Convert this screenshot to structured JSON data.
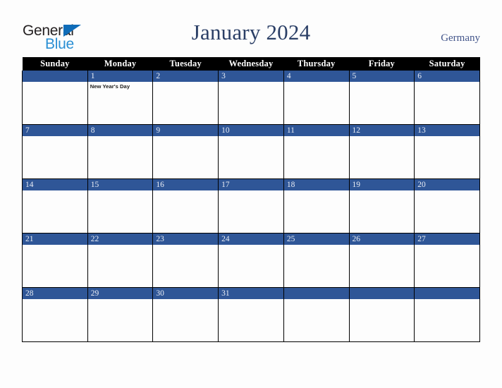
{
  "brand": {
    "name_part1": "General",
    "name_part2": "Blue",
    "triangle_color": "#0f6cb8",
    "blue_text_color": "#2a8fd4",
    "dark_text_color": "#231f20"
  },
  "header": {
    "title": "January 2024",
    "country": "Germany",
    "title_color": "#2b3f66",
    "country_color": "#44568b"
  },
  "theme": {
    "header_row_bg": "#000000",
    "header_row_text": "#ffffff",
    "day_band_bg": "#2f5697",
    "day_band_text": "#e9edf5",
    "cell_bg": "#fdfdfd",
    "grid_line": "#000000",
    "page_bg": "#fdfdfd"
  },
  "weekdays": [
    "Sunday",
    "Monday",
    "Tuesday",
    "Wednesday",
    "Thursday",
    "Friday",
    "Saturday"
  ],
  "weeks": [
    [
      {
        "date": "",
        "event": ""
      },
      {
        "date": "1",
        "event": "New Year's Day"
      },
      {
        "date": "2",
        "event": ""
      },
      {
        "date": "3",
        "event": ""
      },
      {
        "date": "4",
        "event": ""
      },
      {
        "date": "5",
        "event": ""
      },
      {
        "date": "6",
        "event": ""
      }
    ],
    [
      {
        "date": "7",
        "event": ""
      },
      {
        "date": "8",
        "event": ""
      },
      {
        "date": "9",
        "event": ""
      },
      {
        "date": "10",
        "event": ""
      },
      {
        "date": "11",
        "event": ""
      },
      {
        "date": "12",
        "event": ""
      },
      {
        "date": "13",
        "event": ""
      }
    ],
    [
      {
        "date": "14",
        "event": ""
      },
      {
        "date": "15",
        "event": ""
      },
      {
        "date": "16",
        "event": ""
      },
      {
        "date": "17",
        "event": ""
      },
      {
        "date": "18",
        "event": ""
      },
      {
        "date": "19",
        "event": ""
      },
      {
        "date": "20",
        "event": ""
      }
    ],
    [
      {
        "date": "21",
        "event": ""
      },
      {
        "date": "22",
        "event": ""
      },
      {
        "date": "23",
        "event": ""
      },
      {
        "date": "24",
        "event": ""
      },
      {
        "date": "25",
        "event": ""
      },
      {
        "date": "26",
        "event": ""
      },
      {
        "date": "27",
        "event": ""
      }
    ],
    [
      {
        "date": "28",
        "event": ""
      },
      {
        "date": "29",
        "event": ""
      },
      {
        "date": "30",
        "event": ""
      },
      {
        "date": "31",
        "event": ""
      },
      {
        "date": "",
        "event": ""
      },
      {
        "date": "",
        "event": ""
      },
      {
        "date": "",
        "event": ""
      }
    ]
  ]
}
